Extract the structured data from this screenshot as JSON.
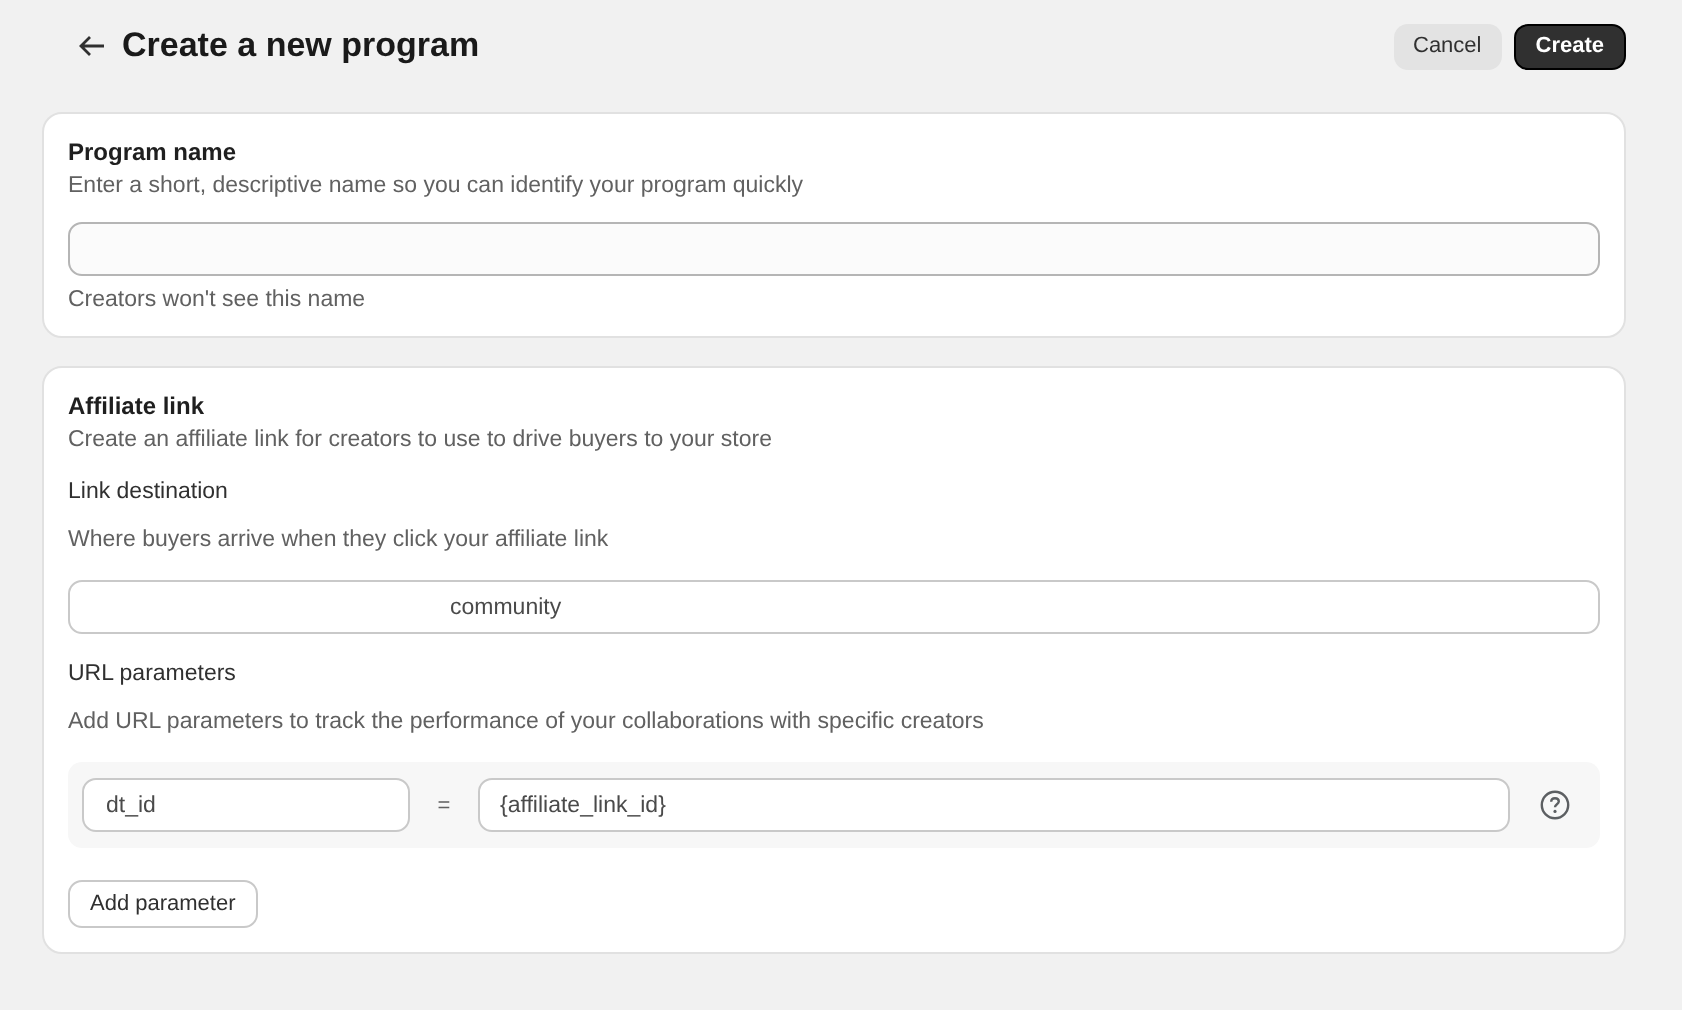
{
  "page": {
    "title": "Create a new program"
  },
  "actions": {
    "cancel": "Cancel",
    "create": "Create"
  },
  "program_name": {
    "title": "Program name",
    "description": "Enter a short, descriptive name so you can identify your program quickly",
    "help": "Creators won't see this name"
  },
  "affiliate_link": {
    "title": "Affiliate link",
    "description": "Create an affiliate link for creators to use to drive buyers to your store",
    "link_destination": {
      "label": "Link destination",
      "description": "Where buyers arrive when they click your affiliate link",
      "value": "community"
    },
    "url_parameters": {
      "label": "URL parameters",
      "description": "Add URL parameters to track the performance of your collaborations with specific creators",
      "rows": [
        {
          "key": "dt_id",
          "separator": "=",
          "value": "{affiliate_link_id}"
        }
      ],
      "add_button": "Add parameter"
    }
  }
}
